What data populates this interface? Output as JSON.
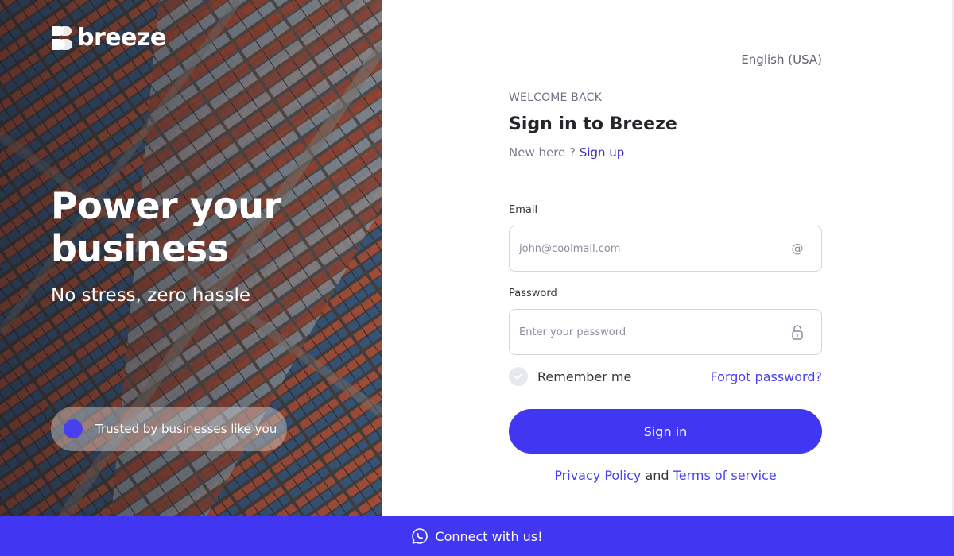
{
  "brand": {
    "name": "breeze"
  },
  "hero": {
    "title": "Power your business",
    "subtitle": "No stress, zero hassle",
    "trust_text": "Trusted by businesses like you"
  },
  "language": "English (USA)",
  "form": {
    "eyebrow": "WELCOME BACK",
    "title": "Sign in to Breeze",
    "new_here": "New here ?",
    "signup_link": "Sign up",
    "email_label": "Email",
    "email_placeholder": "john@coolmail.com",
    "email_value": "",
    "email_icon": "at-icon",
    "password_label": "Password",
    "password_placeholder": "Enter your password",
    "password_value": "",
    "password_icon": "lock-icon",
    "remember_label": "Remember me",
    "remember_checked": true,
    "forgot_link": "Forgot password?",
    "submit_label": "Sign in",
    "privacy_link": "Privacy Policy",
    "and": "and",
    "terms_link": "Terms of service"
  },
  "footer": {
    "label": "Connect with us!",
    "icon": "whatsapp-icon"
  },
  "colors": {
    "accent": "#4136f2",
    "link": "#4a3ff0",
    "text": "#25252b"
  }
}
